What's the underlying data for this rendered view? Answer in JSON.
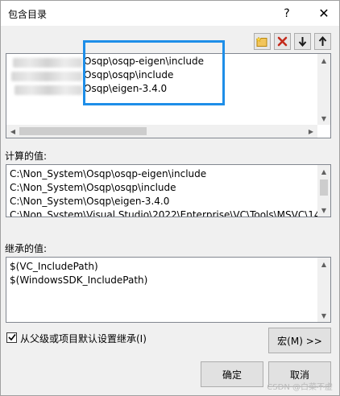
{
  "window": {
    "title": "包含目录",
    "help_glyph": "?",
    "close_glyph": "✕"
  },
  "toolbar": {
    "icons": [
      "new-line-icon",
      "delete-icon",
      "move-down-icon",
      "move-up-icon"
    ]
  },
  "include_dirs": {
    "lines": [
      "Osqp\\osqp-eigen\\include",
      "Osqp\\osqp\\include",
      "Osqp\\eigen-3.4.0"
    ]
  },
  "computed": {
    "label": "计算的值:",
    "lines": [
      "C:\\Non_System\\Osqp\\osqp-eigen\\include",
      "C:\\Non_System\\Osqp\\osqp\\include",
      "C:\\Non_System\\Osqp\\eigen-3.4.0",
      "C:\\Non_System\\Visual Studio\\2022\\Enterprise\\VC\\Tools\\MSVC\\14"
    ]
  },
  "inherited": {
    "label": "继承的值:",
    "lines": [
      "$(VC_IncludePath)",
      "$(WindowsSDK_IncludePath)"
    ]
  },
  "inherit_checkbox": {
    "label": "从父级或项目默认设置继承(I)",
    "checked": true
  },
  "buttons": {
    "macros": "宏(M) >>",
    "ok": "确定",
    "cancel": "取消"
  },
  "colors": {
    "highlight_border": "#1e8ee8",
    "delete_red": "#c42b1c"
  },
  "watermark": "CSDN @白菜不虚"
}
